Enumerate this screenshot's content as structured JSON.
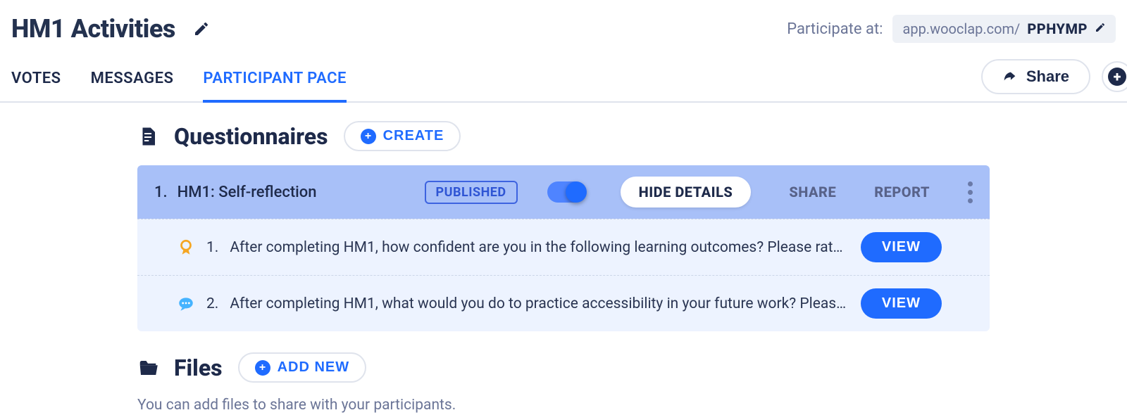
{
  "header": {
    "title": "HM1 Activities",
    "participate_label": "Participate at:",
    "participate_domain": "app.wooclap.com/",
    "participate_code": "PPHYMP"
  },
  "tabs": {
    "votes": "VOTES",
    "messages": "MESSAGES",
    "participant_pace": "PARTICIPANT PACE",
    "active": "participant_pace"
  },
  "actions": {
    "share": "Share"
  },
  "questionnaires": {
    "heading": "Questionnaires",
    "create_label": "CREATE",
    "items": [
      {
        "index": "1.",
        "title": "HM1: Self-reflection",
        "status": "PUBLISHED",
        "toggle_on": true,
        "hide_details_label": "HIDE DETAILS",
        "share_label": "SHARE",
        "report_label": "REPORT",
        "questions": [
          {
            "icon": "badge",
            "number": "1.",
            "text": "After completing HM1, how confident are you in the following learning outcomes? Please rate fr…",
            "view_label": "VIEW"
          },
          {
            "icon": "chat",
            "number": "2.",
            "text": "After completing HM1, what would you do to practice accessibility in your future work? Please li…",
            "view_label": "VIEW"
          }
        ]
      }
    ]
  },
  "files": {
    "heading": "Files",
    "add_label": "ADD NEW",
    "hint": "You can add files to share with your participants."
  }
}
